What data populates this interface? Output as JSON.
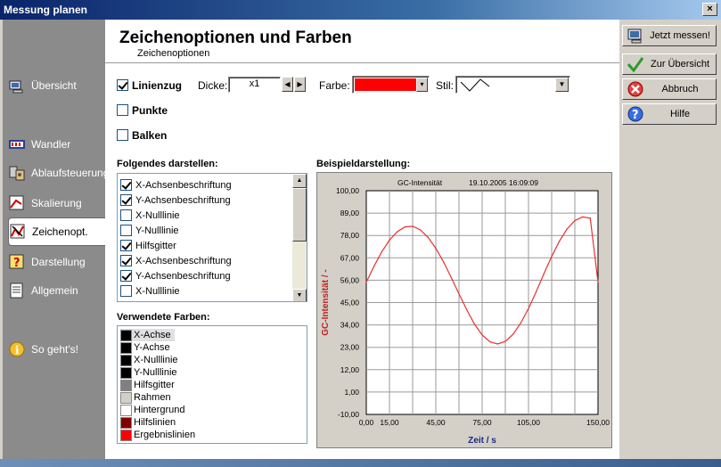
{
  "window": {
    "title": "Messung planen",
    "close": "×"
  },
  "nav": {
    "items": [
      {
        "id": "uebersicht",
        "label": "Übersicht"
      },
      {
        "id": "wandler",
        "label": "Wandler"
      },
      {
        "id": "ablauf",
        "label": "Ablaufsteuerung"
      },
      {
        "id": "skalierung",
        "label": "Skalierung"
      },
      {
        "id": "zeichenopt",
        "label": "Zeichenopt."
      },
      {
        "id": "darstellung",
        "label": "Darstellung"
      },
      {
        "id": "allgemein",
        "label": "Allgemein"
      },
      {
        "id": "sogehts",
        "label": "So geht's!"
      }
    ],
    "active": "zeichenopt"
  },
  "header": {
    "title": "Zeichenoptionen und Farben",
    "subtitle": "Zeichenoptionen"
  },
  "options": {
    "linienzug": {
      "label": "Linienzug",
      "checked": true
    },
    "punkte": {
      "label": "Punkte",
      "checked": false
    },
    "balken": {
      "label": "Balken",
      "checked": false
    },
    "dicke_label": "Dicke:",
    "dicke_value": "x1",
    "farbe_label": "Farbe:",
    "farbe_color": "#ff0000",
    "stil_label": "Stil:"
  },
  "darstellen": {
    "heading": "Folgendes darstellen:",
    "items": [
      {
        "label": "X-Achsenbeschriftung",
        "checked": true
      },
      {
        "label": "Y-Achsenbeschriftung",
        "checked": true
      },
      {
        "label": "X-Nulllinie",
        "checked": false
      },
      {
        "label": "Y-Nulllinie",
        "checked": false
      },
      {
        "label": "Hilfsgitter",
        "checked": true
      },
      {
        "label": "X-Achsenbeschriftung",
        "checked": true
      },
      {
        "label": "Y-Achsenbeschriftung",
        "checked": true
      },
      {
        "label": "X-Nulllinie",
        "checked": false
      }
    ]
  },
  "farben": {
    "heading": "Verwendete Farben:",
    "items": [
      {
        "label": "X-Achse",
        "color": "#000000"
      },
      {
        "label": "Y-Achse",
        "color": "#000000"
      },
      {
        "label": "X-Nulllinie",
        "color": "#000000"
      },
      {
        "label": "Y-Nulllinie",
        "color": "#000000"
      },
      {
        "label": "Hilfsgitter",
        "color": "#808080"
      },
      {
        "label": "Rahmen",
        "color": "#d4d0c8"
      },
      {
        "label": "Hintergrund",
        "color": "#ffffff"
      },
      {
        "label": "Hilfslinien",
        "color": "#800000"
      },
      {
        "label": "Ergebnislinien",
        "color": "#ff0000"
      }
    ]
  },
  "beispiel": {
    "heading": "Beispieldarstellung:"
  },
  "chart_data": {
    "type": "line",
    "title": "GC-Intensität",
    "timestamp": "19.10.2005 16:09:09",
    "xlabel": "Zeit / s",
    "ylabel": "GC-Intensität / -",
    "xlim": [
      0,
      150
    ],
    "ylim": [
      -10,
      100
    ],
    "x_ticks": [
      "0,00",
      "15,00",
      "45,00",
      "75,00",
      "105,00",
      "150,00"
    ],
    "y_ticks": [
      "100,00",
      "89,00",
      "78,00",
      "67,00",
      "56,00",
      "45,00",
      "34,00",
      "23,00",
      "12,00",
      "1,00",
      "-10,00"
    ],
    "x": [
      0,
      5,
      10,
      15,
      20,
      25,
      30,
      35,
      40,
      45,
      50,
      55,
      60,
      65,
      70,
      75,
      80,
      85,
      90,
      95,
      100,
      105,
      110,
      115,
      120,
      125,
      130,
      135,
      140,
      145,
      150
    ],
    "y": [
      55,
      62.9,
      69.9,
      75.7,
      79.8,
      82.2,
      82.5,
      80.7,
      77.1,
      71.7,
      65,
      57.3,
      49.3,
      41.5,
      34.5,
      29.1,
      25.7,
      24.6,
      25.9,
      29.4,
      34.9,
      42.1,
      50.4,
      59.2,
      67.7,
      75.2,
      81.2,
      85.3,
      87.1,
      86.5,
      55
    ],
    "grid": true,
    "series_color": "#e83030"
  },
  "buttons": {
    "jetzt": "Jetzt messen!",
    "zur": "Zur Übersicht",
    "abbruch": "Abbruch",
    "hilfe": "Hilfe"
  }
}
